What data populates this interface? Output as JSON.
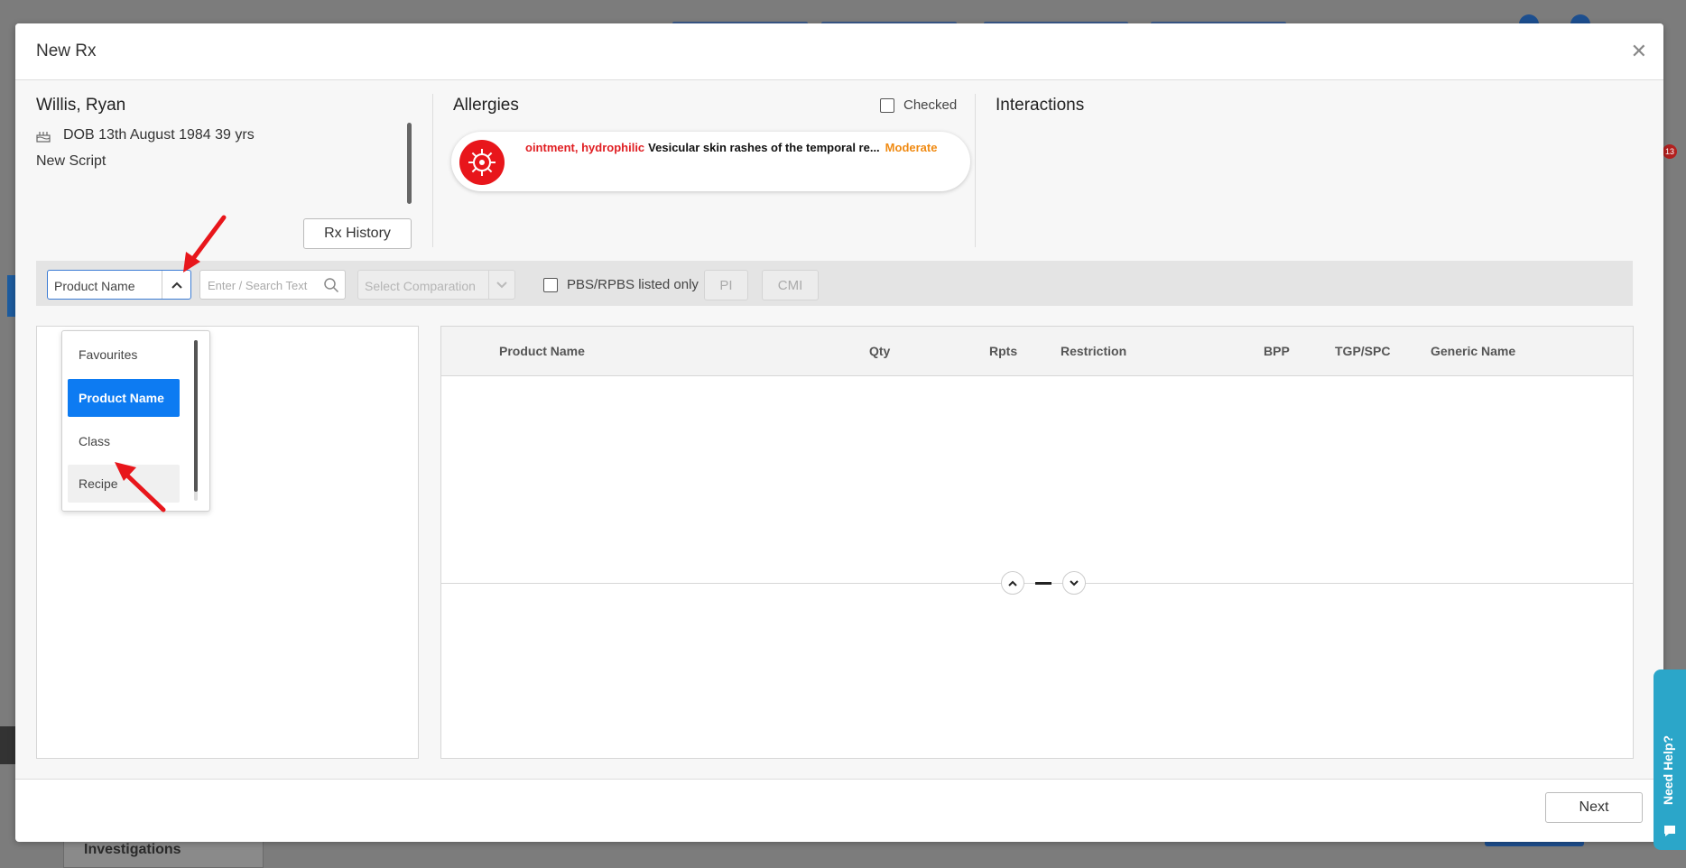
{
  "background": {
    "tab_label": "Investigations"
  },
  "modal": {
    "title": "New Rx",
    "close_icon": "close-icon"
  },
  "patient": {
    "name": "Willis, Ryan",
    "dob": "DOB 13th August 1984 39 yrs",
    "script_type": "New Script",
    "rx_history_label": "Rx History"
  },
  "allergies": {
    "title": "Allergies",
    "checked_label": "Checked",
    "checked": false,
    "items": [
      {
        "substance": "ointment, hydrophilic",
        "reaction": "Vesicular skin rashes of the temporal re...",
        "severity": "Moderate"
      }
    ]
  },
  "interactions": {
    "title": "Interactions"
  },
  "toolbar": {
    "search_by_value": "Product Name",
    "search_placeholder": "Enter / Search Text",
    "comparison_placeholder": "Select Comparation",
    "pbs_label": "PBS/RPBS listed only",
    "pi_label": "PI",
    "cmi_label": "CMI"
  },
  "dropdown": {
    "options": [
      "Favourites",
      "Product Name",
      "Class",
      "Recipe"
    ],
    "selected": "Product Name",
    "hovered": "Recipe"
  },
  "grid": {
    "columns": [
      "Product Name",
      "Qty",
      "Rpts",
      "Restriction",
      "BPP",
      "TGP/SPC",
      "Generic Name"
    ],
    "rows": []
  },
  "footer": {
    "next_label": "Next"
  },
  "help": {
    "label": "Need Help?"
  },
  "colors": {
    "accent": "#0d7bf2",
    "allergy_red": "#e01e22",
    "severity_orange": "#f08a12",
    "help_teal": "#2ba6c9"
  }
}
